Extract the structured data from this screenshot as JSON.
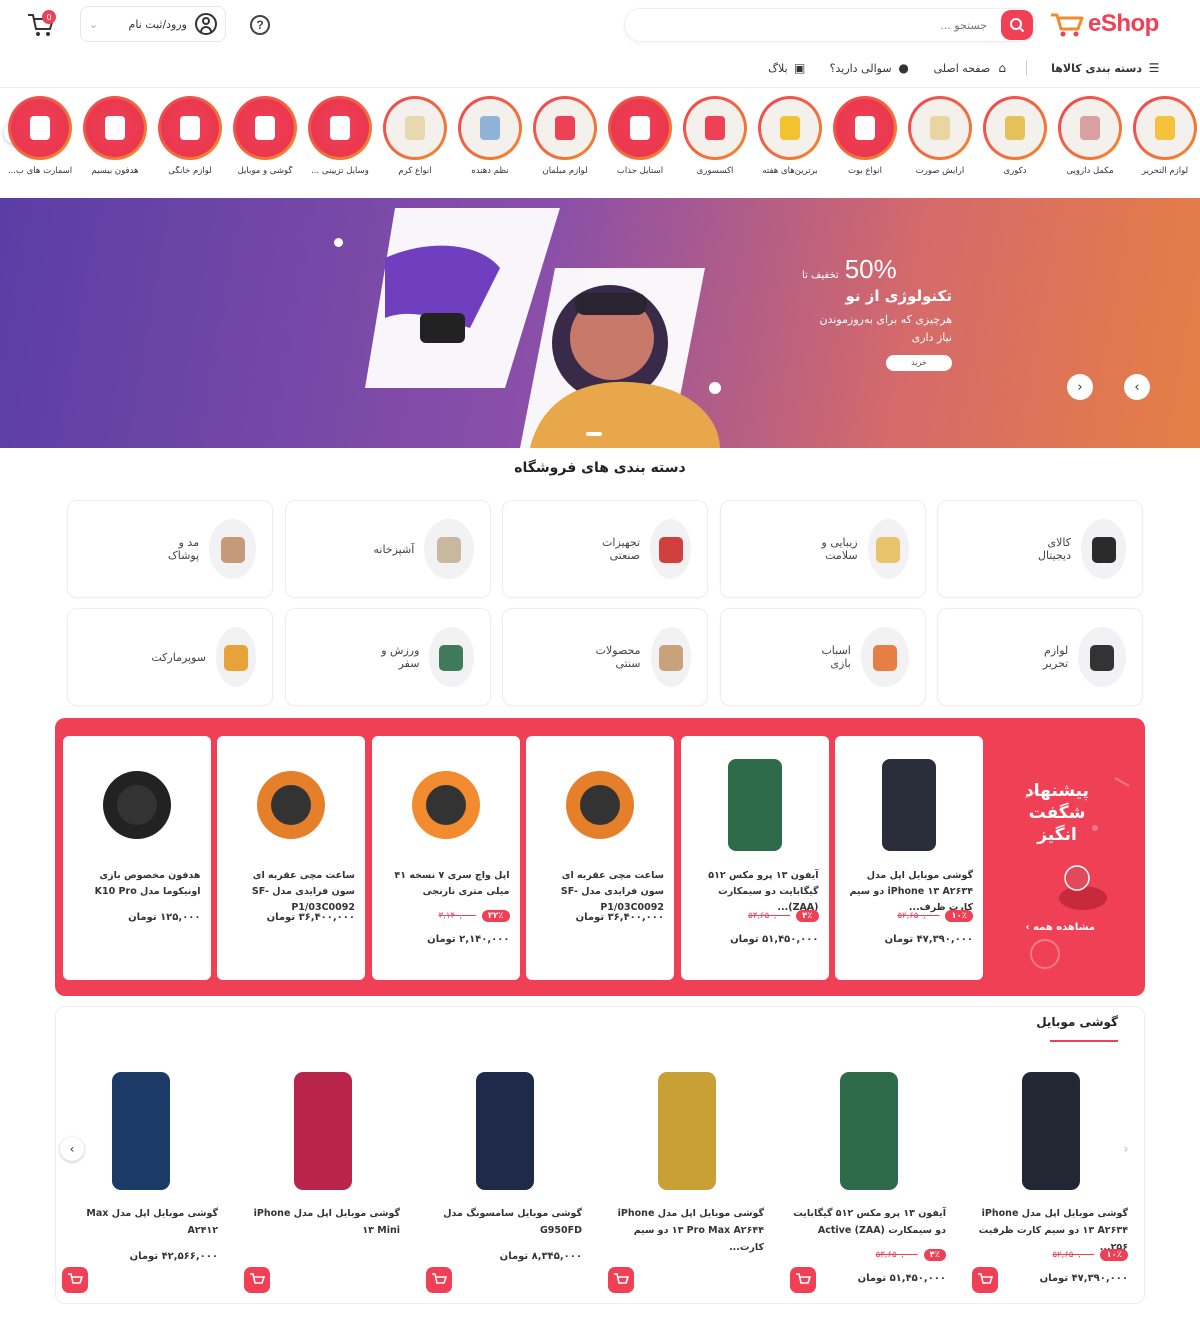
{
  "brand": {
    "logo_text": "eShop",
    "accent": "#ef4056"
  },
  "header": {
    "search_placeholder": "جستجو ...",
    "login_label": "ورود/ثبت نام",
    "cart_count": "0"
  },
  "nav": {
    "categories": "دسته بندی کالاها",
    "home": "صفحه اصلی",
    "question": "سوالی دارید؟",
    "blog": "بلاگ"
  },
  "stories": [
    {
      "label": "لوازم التحریر",
      "icon": "stationery-icon"
    },
    {
      "label": "مکمل دارویی",
      "icon": "supplement-icon"
    },
    {
      "label": "دکوری",
      "icon": "decor-icon"
    },
    {
      "label": "آرایش صورت",
      "icon": "makeup-icon"
    },
    {
      "label": "انواع بوت",
      "icon": "boot-icon"
    },
    {
      "label": "برترین‌های هفته",
      "icon": "award-icon"
    },
    {
      "label": "اکسسوری",
      "icon": "accessory-icon"
    },
    {
      "label": "استایل جذاب",
      "icon": "style-icon"
    },
    {
      "label": "لوازم مبلمان",
      "icon": "furniture-icon"
    },
    {
      "label": "نظم دهنده",
      "icon": "organizer-icon"
    },
    {
      "label": "انواع کرم",
      "icon": "cream-icon"
    },
    {
      "label": "وسایل تزیینی ...",
      "icon": "lamp-icon"
    },
    {
      "label": "گوشی و موبایل",
      "icon": "devices-icon"
    },
    {
      "label": "لوازم خانگی",
      "icon": "appliance-icon"
    },
    {
      "label": "هدفون بیسیم",
      "icon": "headphone-icon"
    },
    {
      "label": "اسمارت های ب...",
      "icon": "tv-icon"
    }
  ],
  "hero": {
    "off_prefix": "تخفیف تا",
    "off_value": "50%",
    "title": "تکنولوژی از نو",
    "subtitle": "هرچیزی که برای به‌روزموندن نیاز داری",
    "button": "خرید"
  },
  "store_categories_title": "دسته بندی های فروشگاه",
  "store_categories": [
    {
      "label": "کالای دیجیتال",
      "icon": "digital-icon"
    },
    {
      "label": "زیبایی و سلامت",
      "icon": "beauty-icon"
    },
    {
      "label": "تجهیزات صنعتی",
      "icon": "tools-icon"
    },
    {
      "label": "آشپزخانه",
      "icon": "kitchen-icon"
    },
    {
      "label": "مد و پوشاک",
      "icon": "fashion-icon"
    },
    {
      "label": "لوازم تحریر",
      "icon": "stationery-icon"
    },
    {
      "label": "اسباب بازی",
      "icon": "toy-icon"
    },
    {
      "label": "محصولات سنتی",
      "icon": "traditional-icon"
    },
    {
      "label": "ورزش و سفر",
      "icon": "sport-icon"
    },
    {
      "label": "سوپرمارکت",
      "icon": "supermarket-icon"
    }
  ],
  "amazing": {
    "title": "پیشنهاد شگفت انگیز",
    "link": "مشاهده همه ›",
    "items": [
      {
        "name": "گوشی موبایل اپل مدل iPhone ۱۳ A۲۶۳۴ دو سیم کارت ظرف...",
        "discount": "۱۰٪",
        "old": "۵۲,۶۵۰,۰۰۰",
        "price": "۴۷,۳۹۰,۰۰۰ تومان",
        "icon": "iphone13-image"
      },
      {
        "name": "آیفون ۱۳ پرو مکس ۵۱۲ گیگابایت دو سیمکارت (ZAA)...",
        "discount": "۴٪",
        "old": "۵۳,۶۵۰,۰۰۰",
        "price": "۵۱,۴۵۰,۰۰۰ تومان",
        "icon": "iphone13pro-image"
      },
      {
        "name": "ساعت مچی عقربه ای سون فرایدی مدل SF-P1/03C0092",
        "discount": "",
        "old": "",
        "price": "۳۶,۴۰۰,۰۰۰ تومان",
        "icon": "watch-image"
      },
      {
        "name": "اپل واچ سری ۷ نسخه ۴۱ میلی متری نارنجی",
        "discount": "۳۲٪",
        "old": "۳,۱۴۰,۰۰۰",
        "price": "۲,۱۴۰,۰۰۰ تومان",
        "icon": "applewatch-image"
      },
      {
        "name": "ساعت مچی عقربه ای سون فرایدی مدل SF-P1/03C0092",
        "discount": "",
        "old": "",
        "price": "۳۶,۴۰۰,۰۰۰ تومان",
        "icon": "watch-image"
      },
      {
        "name": "هدفون مخصوص بازی اونیکوما مدل K10 Pro",
        "discount": "",
        "old": "",
        "price": "۱۲۵,۰۰۰ تومان",
        "icon": "headset-image"
      }
    ]
  },
  "mobile": {
    "title": "گوشی موبایل",
    "items": [
      {
        "name": "گوشی موبایل اپل مدل iPhone ۱۳ A۲۶۳۴ دو سیم کارت ظرفیت ۲۵۶...",
        "discount": "۱۰٪",
        "old": "۵۲,۶۵۰,۰۰۰",
        "price": "۴۷,۳۹۰,۰۰۰ تومان"
      },
      {
        "name": "آیفون ۱۳ پرو مکس ۵۱۲ گیگابایت دو سیمکارت Active (ZAA)",
        "discount": "۴٪",
        "old": "۵۳,۶۵۰,۰۰۰",
        "price": "۵۱,۴۵۰,۰۰۰ تومان"
      },
      {
        "name": "گوشی موبایل اپل مدل iPhone ۱۳ Pro Max A۲۶۴۴ دو سیم کارت...",
        "discount": "",
        "old": "",
        "price": ""
      },
      {
        "name": "گوشی موبایل سامسونگ مدل G950FD",
        "discount": "",
        "old": "",
        "price": "۸,۳۴۵,۰۰۰ تومان"
      },
      {
        "name": "گوشی موبایل اپل مدل iPhone ۱۳ Mini",
        "discount": "",
        "old": "",
        "price": ""
      },
      {
        "name": "گوشی موبایل اپل مدل Max A۲۴۱۲",
        "discount": "",
        "old": "",
        "price": "۴۲,۵۶۶,۰۰۰ تومان"
      }
    ]
  }
}
